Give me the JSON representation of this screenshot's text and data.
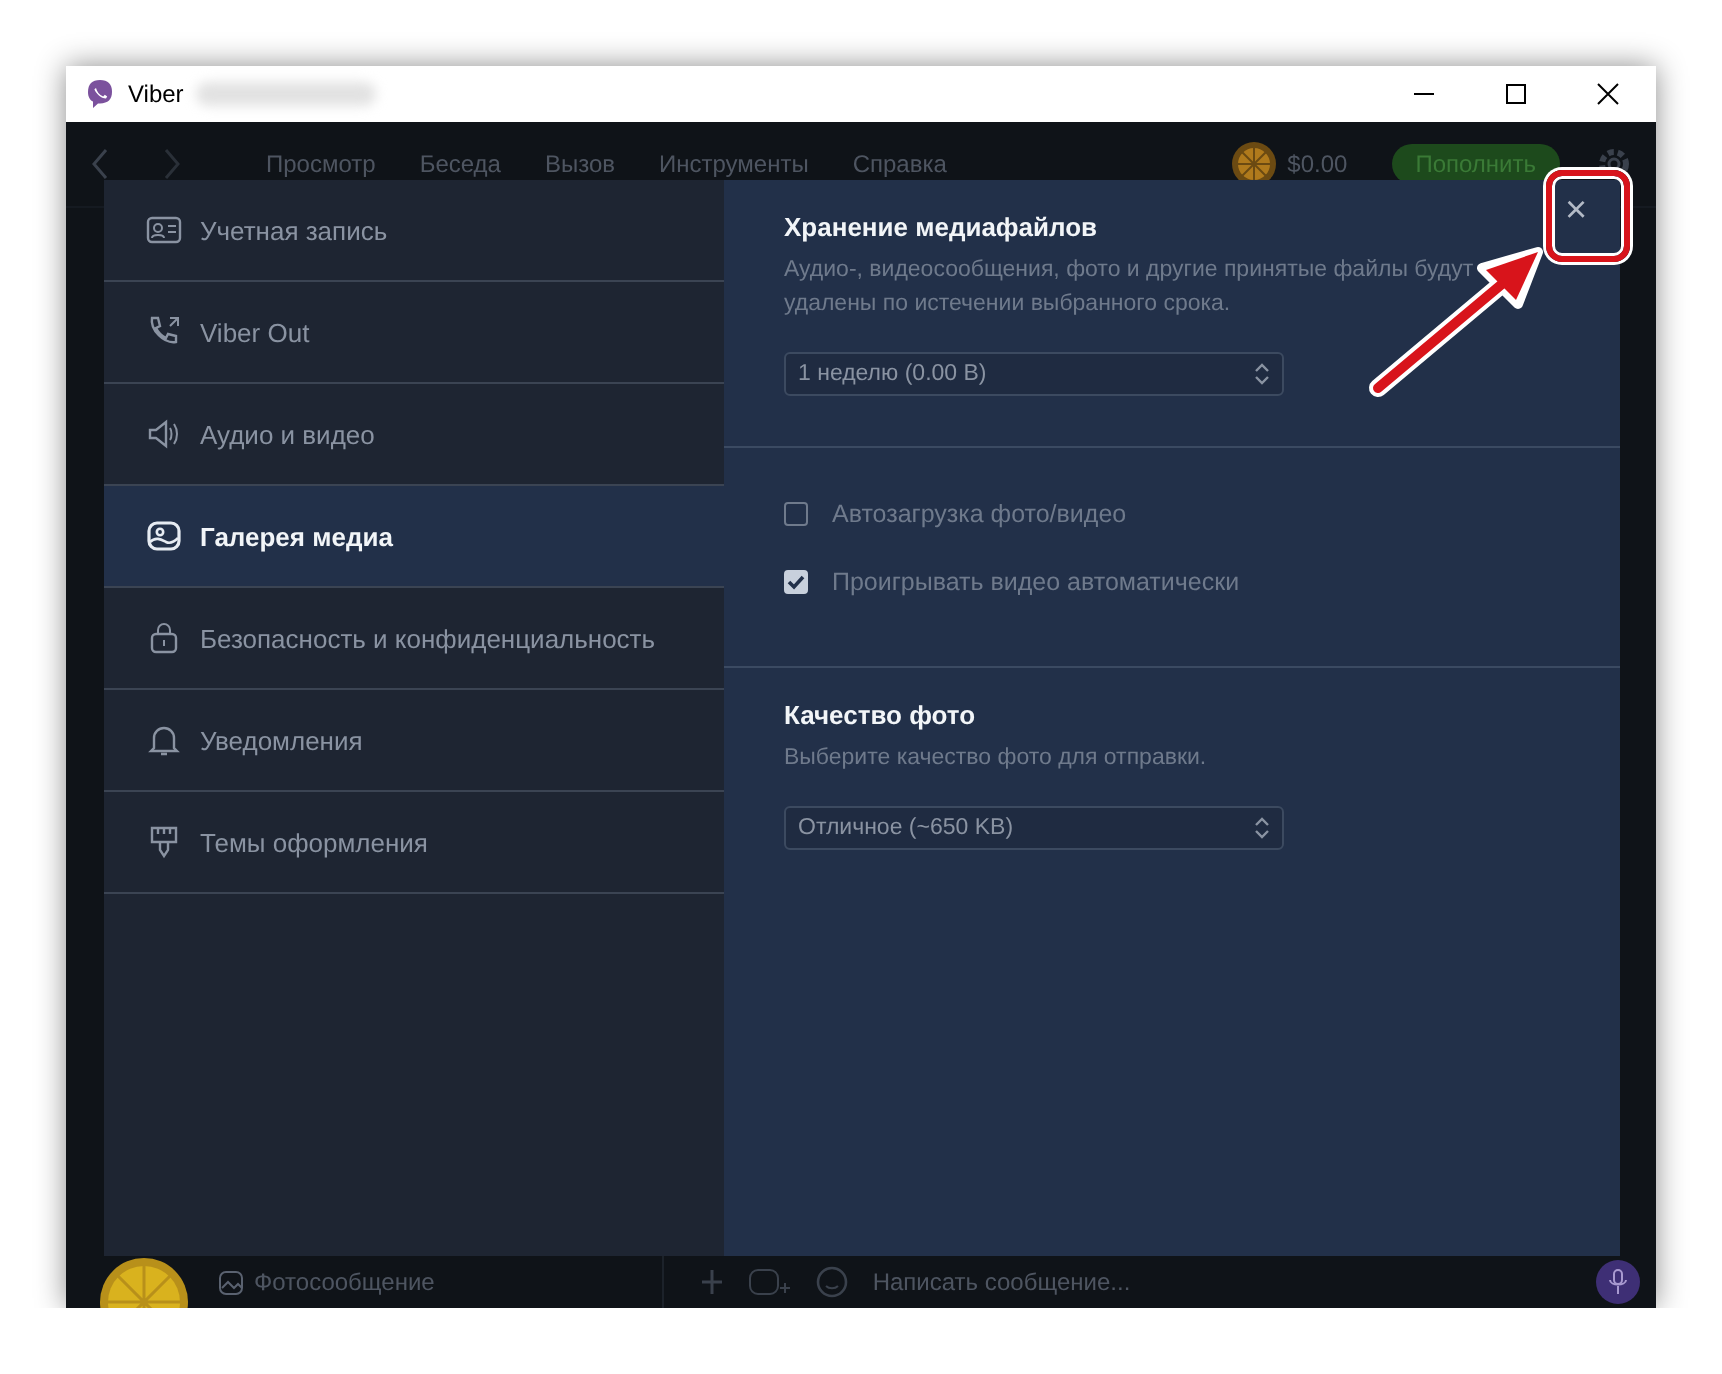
{
  "window": {
    "title": "Viber"
  },
  "menu": [
    "Просмотр",
    "Беседа",
    "Вызов",
    "Инструменты",
    "Справка"
  ],
  "balance": "$0.00",
  "top_up_button": "Пополнить",
  "settings": {
    "close": "×",
    "nav": [
      {
        "label": "Учетная запись",
        "selected": false
      },
      {
        "label": "Viber Out",
        "selected": false
      },
      {
        "label": "Аудио и видео",
        "selected": false
      },
      {
        "label": "Галерея медиа",
        "selected": true
      },
      {
        "label": "Безопасность и конфиденциальность",
        "selected": false
      },
      {
        "label": "Уведомления",
        "selected": false
      },
      {
        "label": "Темы оформления",
        "selected": false
      }
    ],
    "sections": [
      [
        {
          "kind": "heading",
          "text": "Хранение медиафайлов"
        },
        {
          "kind": "text",
          "text": "Аудио-, видеосообщения, фото и другие принятые файлы будут удалены по истечении выбранного срока."
        },
        {
          "kind": "select",
          "value": "1 неделю (0.00 B)"
        }
      ],
      [
        {
          "kind": "checkbox",
          "label": "Автозагрузка фото/видео",
          "checked": false
        },
        {
          "kind": "checkbox",
          "label": "Проигрывать видео автоматически",
          "checked": true
        }
      ],
      [
        {
          "kind": "heading",
          "text": "Качество фото"
        },
        {
          "kind": "text",
          "text": "Выберите качество фото для отправки."
        },
        {
          "kind": "select",
          "value": "Отличное (~650 KB)"
        }
      ]
    ]
  },
  "chat_preview": {
    "last_message": "Фотосообщение"
  },
  "composer": {
    "placeholder": "Написать сообщение..."
  }
}
